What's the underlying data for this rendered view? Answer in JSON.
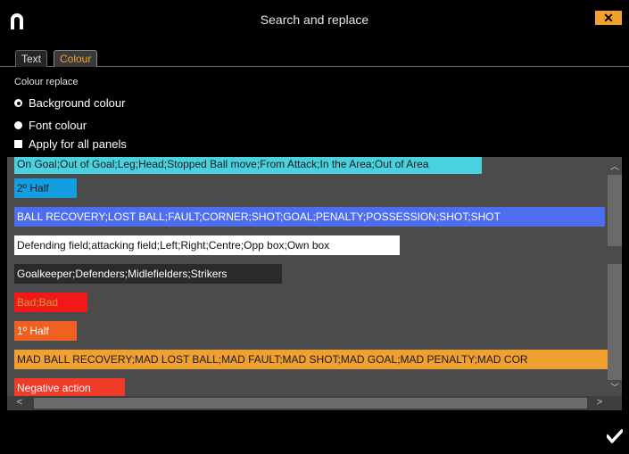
{
  "window": {
    "title": "Search and replace",
    "close_label": "✕",
    "accent_color": "#f0a030"
  },
  "tabs": [
    {
      "label": "Text",
      "active": false
    },
    {
      "label": "Colour",
      "active": true
    }
  ],
  "colour_replace": {
    "section_title": "Colour replace",
    "options": [
      {
        "label": "Background colour",
        "selected": true
      },
      {
        "label": "Font colour",
        "selected": false
      }
    ],
    "apply_all": {
      "label": "Apply for all panels",
      "checked": false
    }
  },
  "entries": [
    {
      "text": "On Goal;Out of Goal;Leg;Head;Stopped Ball move;From Attack;In the Area;Out of Area",
      "bg": "#49d1e0",
      "fg": "#1b1b1b"
    },
    {
      "text": "2º Half",
      "bg": "#129ee0",
      "fg": "#1b1b1b"
    },
    {
      "text": "BALL RECOVERY;LOST BALL;FAULT;CORNER;SHOT;GOAL;PENALTY;POSSESSION;SHOT;SHOT",
      "bg": "#4d6ef0",
      "fg": "#ffffff"
    },
    {
      "text": "Defending field;attacking field;Left;Right;Centre;Opp box;Own box",
      "bg": "#ffffff",
      "fg": "#111111"
    },
    {
      "text": "Goalkeeper;Defenders;Midlefielders;Strikers",
      "bg": "#2a2a2a",
      "fg": "#ffffff"
    },
    {
      "text": "Bad;Bad",
      "bg": "#f01818",
      "fg": "#c9a030"
    },
    {
      "text": "1º Half",
      "bg": "#f06020",
      "fg": "#ffffff"
    },
    {
      "text": "MAD BALL RECOVERY;MAD LOST BALL;MAD FAULT;MAD SHOT;MAD GOAL;MAD PENALTY;MAD COR",
      "bg": "#f0a030",
      "fg": "#1b1b1b"
    },
    {
      "text": "Negative action",
      "bg": "#f03a2a",
      "fg": "#ffffff"
    }
  ],
  "icons": {
    "app": "app-logo-icon",
    "close": "close-icon",
    "confirm": "checkmark-icon",
    "scroll_up": "chevron-up-icon",
    "scroll_down": "chevron-down-icon",
    "scroll_left": "chevron-left-icon",
    "scroll_right": "chevron-right-icon"
  }
}
